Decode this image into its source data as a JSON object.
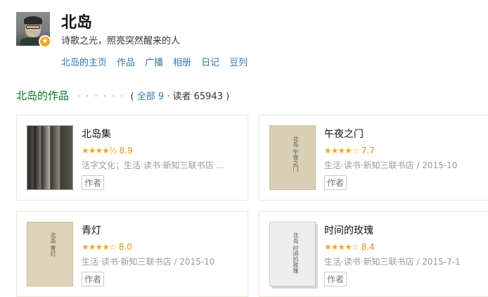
{
  "author": {
    "name": "北岛",
    "motto": "诗歌之光，照亮突然醒来的人"
  },
  "nav": [
    {
      "label": "北岛的主页"
    },
    {
      "label": "作品"
    },
    {
      "label": "广播"
    },
    {
      "label": "相册"
    },
    {
      "label": "日记"
    },
    {
      "label": "豆列"
    }
  ],
  "section": {
    "title": "北岛的作品",
    "dots": "· · · · · ·",
    "open": "( ",
    "all_link": "全部 9",
    "readers": " · 读者 65943 )"
  },
  "colors": {
    "link": "#3377aa",
    "section_title": "#007722",
    "star": "#f5a623"
  },
  "works": [
    {
      "title": "北岛集",
      "rating": 8.9,
      "stars": "★★★★½",
      "publisher": "活字文化；生活·读书·新知三联书店 ...",
      "role": "作者",
      "cover_text": ""
    },
    {
      "title": "午夜之门",
      "rating": 7.7,
      "stars": "★★★★☆",
      "publisher": "生活·读书·新知三联书店 / 2015-10",
      "role": "作者",
      "cover_text": "北岛 午夜之门"
    },
    {
      "title": "青灯",
      "rating": 8.0,
      "stars": "★★★★☆",
      "publisher": "生活·读书·新知三联书店 / 2015-10",
      "role": "作者",
      "cover_text": "北岛 青灯"
    },
    {
      "title": "时间的玫瑰",
      "rating": 8.4,
      "stars": "★★★★☆",
      "publisher": "生活·读书·新知三联书店 / 2015-7-1",
      "role": "作者",
      "cover_text": "北岛 时间的玫瑰"
    }
  ]
}
